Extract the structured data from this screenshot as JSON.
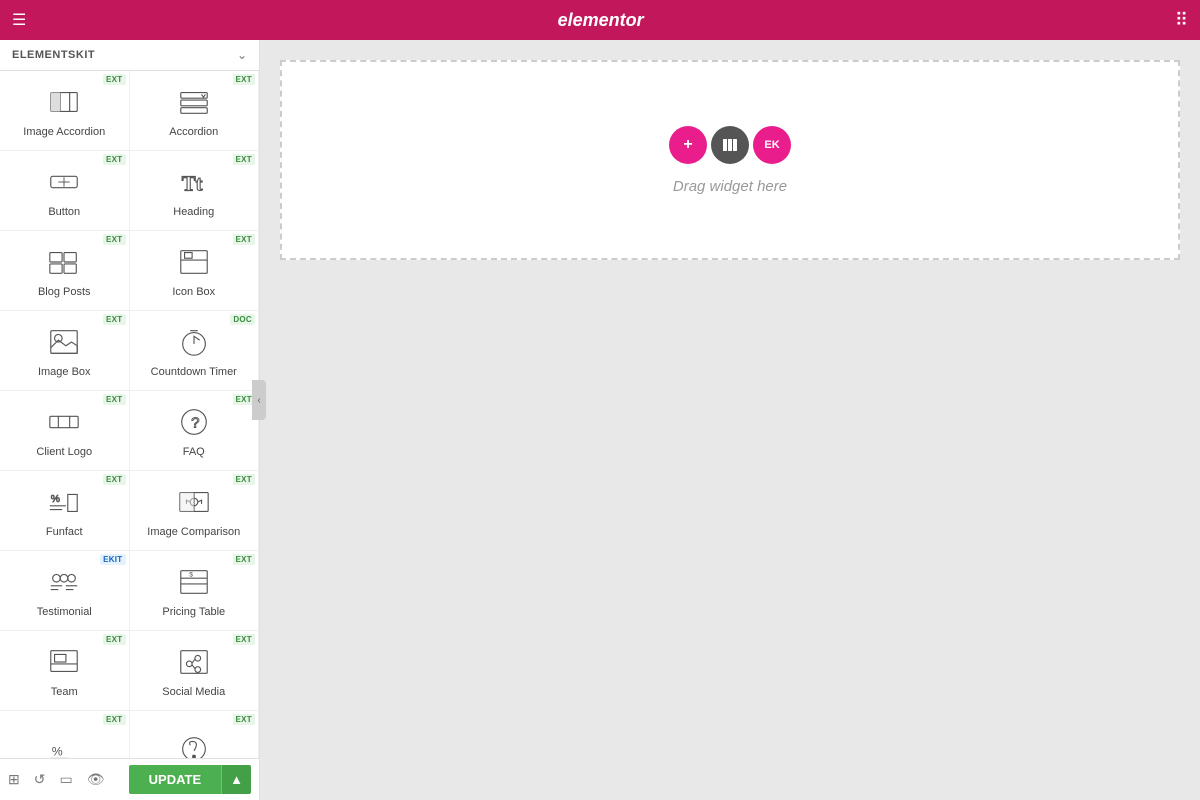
{
  "topbar": {
    "logo": "elementor",
    "grid_icon": "grid-icon",
    "hamburger_icon": "hamburger-icon"
  },
  "sidebar": {
    "header": {
      "title": "ELEMENTSKIT",
      "chevron": "chevron-down-icon"
    },
    "widgets": [
      {
        "id": "image-accordion",
        "label": "Image Accordion",
        "badge": "EXT",
        "badge_type": "ext"
      },
      {
        "id": "accordion",
        "label": "Accordion",
        "badge": "EXT",
        "badge_type": "ext"
      },
      {
        "id": "button",
        "label": "Button",
        "badge": "EXT",
        "badge_type": "ext"
      },
      {
        "id": "heading",
        "label": "Heading",
        "badge": "EXT",
        "badge_type": "ext"
      },
      {
        "id": "blog-posts",
        "label": "Blog Posts",
        "badge": "EXT",
        "badge_type": "ext"
      },
      {
        "id": "icon-box",
        "label": "Icon Box",
        "badge": "EXT",
        "badge_type": "ext"
      },
      {
        "id": "image-box",
        "label": "Image Box",
        "badge": "EXT",
        "badge_type": "ext"
      },
      {
        "id": "countdown-timer",
        "label": "Countdown Timer",
        "badge": "DOC",
        "badge_type": "ext"
      },
      {
        "id": "client-logo",
        "label": "Client Logo",
        "badge": "EXT",
        "badge_type": "ext"
      },
      {
        "id": "faq",
        "label": "FAQ",
        "badge": "EXT",
        "badge_type": "ext"
      },
      {
        "id": "funfact",
        "label": "Funfact",
        "badge": "EXT",
        "badge_type": "ext"
      },
      {
        "id": "image-comparison",
        "label": "Image Comparison",
        "badge": "EXT",
        "badge_type": "ext"
      },
      {
        "id": "testimonial",
        "label": "Testimonial",
        "badge": "EKIT",
        "badge_type": "ekit"
      },
      {
        "id": "pricing-table",
        "label": "Pricing Table",
        "badge": "EXT",
        "badge_type": "ext"
      },
      {
        "id": "team",
        "label": "Team",
        "badge": "EXT",
        "badge_type": "ext"
      },
      {
        "id": "social-media",
        "label": "Social Media",
        "badge": "EXT",
        "badge_type": "ext"
      },
      {
        "id": "widget-17",
        "label": "",
        "badge": "EXT",
        "badge_type": "ext"
      },
      {
        "id": "widget-18",
        "label": "",
        "badge": "EXT",
        "badge_type": "ext"
      }
    ]
  },
  "canvas": {
    "drag_text": "Drag widget here",
    "plus_label": "+",
    "stop_label": "■",
    "ek_label": "EK"
  },
  "bottombar": {
    "update_label": "UPDATE",
    "arrow_label": "▲"
  }
}
